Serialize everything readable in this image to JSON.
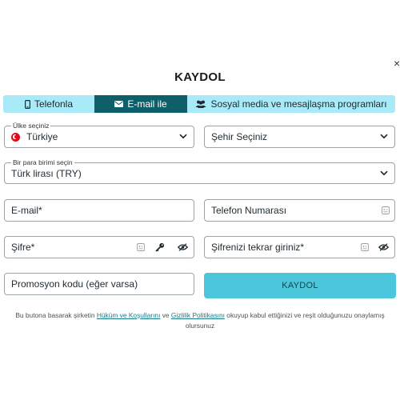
{
  "dialog": {
    "close_symbol": "×",
    "title": "KAYDOL"
  },
  "tabs": [
    {
      "label": "Telefonla",
      "icon": "phone-icon",
      "active": false
    },
    {
      "label": "E-mail ile",
      "icon": "envelope-icon",
      "active": true
    },
    {
      "label": "Sosyal media ve mesajlaşma programları",
      "icon": "users-icon",
      "active": false
    }
  ],
  "form": {
    "country": {
      "label": "Ülke seçiniz",
      "value": "Türkiye",
      "flag": "turkey-flag-icon"
    },
    "city": {
      "value": "Şehir Seçiniz"
    },
    "currency": {
      "label": "Bir para birimi seçin",
      "value": "Türk lirası (TRY)"
    },
    "email": {
      "placeholder": "E-mail*"
    },
    "phone": {
      "placeholder": "Telefon Numarası"
    },
    "password": {
      "placeholder": "Şifre*"
    },
    "password_repeat": {
      "placeholder": "Şifrenizi tekrar giriniz*"
    },
    "promo": {
      "placeholder": "Promosyon kodu (eğer varsa)"
    },
    "submit_label": "KAYDOL"
  },
  "legal": {
    "prefix": "Bu butona basarak şirketin ",
    "terms_link": "Hüküm ve Koşullarını",
    "middle": " ve ",
    "privacy_link": "Gizlilik Politikasını",
    "suffix": " okuyup kabul ettiğinizi ve reşit olduğunuzu onaylamış olursunuz"
  },
  "colors": {
    "tab_active": "#0e5f6a",
    "tab_inactive": "#a8eaf7",
    "submit": "#4cc6da",
    "link": "#1a7a8a"
  }
}
